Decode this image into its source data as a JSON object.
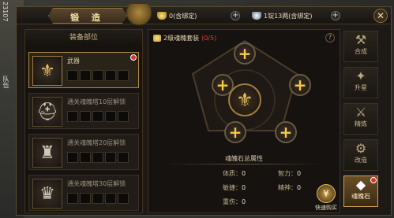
{
  "background": {
    "left_label_top": "23107",
    "left_label_mid": "队伍"
  },
  "header": {
    "title": "锻 造",
    "gold_value": "0(含绑定)",
    "silver_value": "1锭13两(含绑定)",
    "close_symbol": "✕",
    "plus_symbol": "+"
  },
  "left": {
    "header": "装备部位",
    "items": [
      {
        "name": "武器",
        "locked": false,
        "icon": "weapon-icon",
        "glyph": "⚜"
      },
      {
        "name": "通关魂魄塔10层解锁",
        "locked": true,
        "icon": "helmet-icon",
        "glyph": "⛑"
      },
      {
        "name": "通关魂魄塔20层解锁",
        "locked": true,
        "icon": "armor-icon",
        "glyph": "♜"
      },
      {
        "name": "通关魂魄塔30层解锁",
        "locked": true,
        "icon": "necklace-icon",
        "glyph": "♛"
      }
    ]
  },
  "center": {
    "set_label": "2级魂魄套装",
    "set_count": "(0/5)",
    "help_symbol": "?",
    "socket_plus": "+",
    "core_glyph": "⚜",
    "stats_title": "魂魄石总属性",
    "stats": [
      {
        "label": "体质：",
        "value": "0"
      },
      {
        "label": "智力：",
        "value": "0"
      },
      {
        "label": "敏捷：",
        "value": "0"
      },
      {
        "label": "精神：",
        "value": "0"
      },
      {
        "label": "重伤：",
        "value": "0"
      }
    ],
    "quick_buy": "快速购买",
    "quick_buy_glyph": "¥"
  },
  "tabs": [
    {
      "label": "合成",
      "icon": "compose-icon",
      "glyph": "⚒"
    },
    {
      "label": "升星",
      "icon": "star-up-icon",
      "glyph": "✦"
    },
    {
      "label": "精炼",
      "icon": "refine-icon",
      "glyph": "⚔"
    },
    {
      "label": "改造",
      "icon": "reform-icon",
      "glyph": "⚙"
    },
    {
      "label": "魂魄石",
      "icon": "soul-stone-icon",
      "glyph": "◆"
    }
  ],
  "colors": {
    "accent_gold": "#f7c84a",
    "alert_red": "#e03030"
  }
}
